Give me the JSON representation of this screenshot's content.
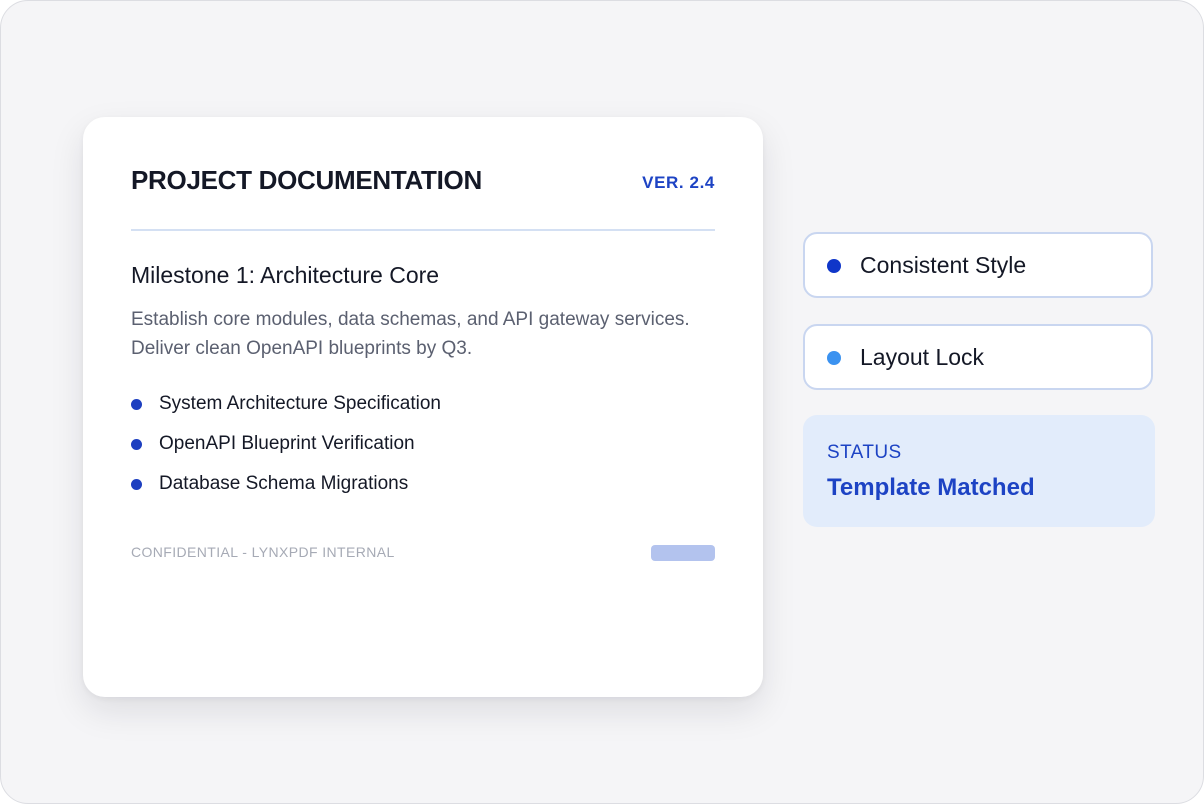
{
  "document": {
    "title": "PROJECT DOCUMENTATION",
    "version": "VER. 2.4",
    "milestone_title": "Milestone 1: Architecture Core",
    "milestone_description": "Establish core modules, data schemas, and API gateway services. Deliver clean OpenAPI blueprints by Q3.",
    "items": [
      "System Architecture Specification",
      "OpenAPI Blueprint Verification",
      "Database Schema Migrations"
    ],
    "footer": "CONFIDENTIAL - LYNXPDF INTERNAL"
  },
  "features": [
    {
      "label": "Consistent Style",
      "dot_color": "#0f36c9"
    },
    {
      "label": "Layout Lock",
      "dot_color": "#3b92f0"
    }
  ],
  "status": {
    "label": "STATUS",
    "value": "Template Matched"
  },
  "colors": {
    "accent": "#1d43c4",
    "bullet": "#1d3fc0",
    "status_background": "#e2ecfb",
    "frame_background": "#f5f5f7"
  }
}
